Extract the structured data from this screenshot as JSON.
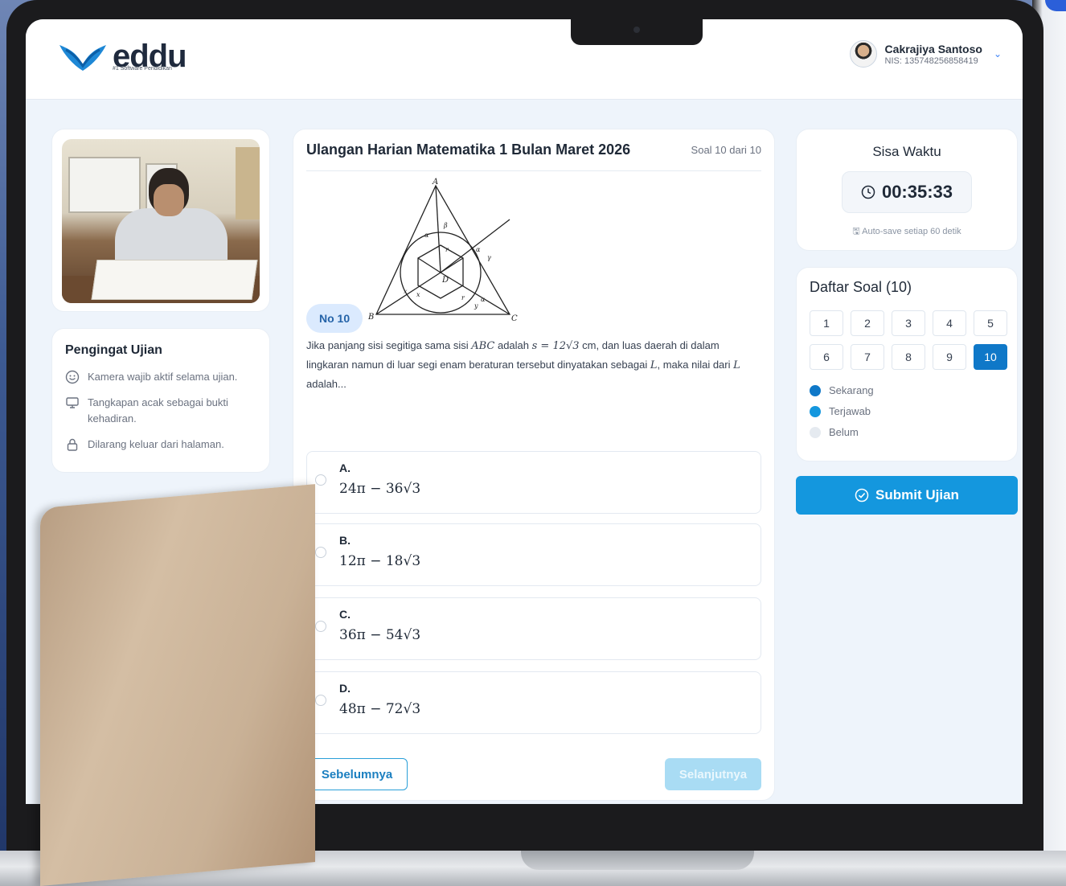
{
  "brand": {
    "name": "eddu",
    "tagline": "#1 Software Pendidikan",
    "color": "#1e88d6"
  },
  "user": {
    "name": "Cakrajiya Santoso",
    "nis": "NIS: 135748256858419"
  },
  "reminder": {
    "title": "Pengingat Ujian",
    "items": [
      {
        "icon": "smile-icon",
        "text": "Kamera wajib aktif selama ujian."
      },
      {
        "icon": "monitor-icon",
        "text": "Tangkapan acak sebagai bukti kehadiran."
      },
      {
        "icon": "lock-icon",
        "text": "Dilarang keluar dari halaman."
      }
    ]
  },
  "question": {
    "exam_title": "Ulangan Harian Matematika 1 Bulan Maret 2026",
    "counter": "Soal 10 dari 10",
    "badge": "No 10",
    "text_prefix": "Jika panjang sisi segitiga sama sisi ",
    "text_abc": "ABC",
    "text_mid": " adalah ",
    "text_s": "s = 12√3",
    "text_rest": " cm, dan luas daerah di dalam lingkaran namun di luar segi enam beraturan tersebut dinyatakan sebagai ",
    "text_L": "L",
    "text_end1": ", maka nilai dari ",
    "text_L2": "L",
    "text_end2": " adalah...",
    "figure_labels": {
      "A": "A",
      "B": "B",
      "C": "C",
      "D": "D",
      "alpha": "α",
      "beta": "β",
      "gamma": "γ",
      "r": "r",
      "x": "x",
      "y": "y"
    },
    "options": [
      {
        "letter": "A.",
        "value": "24π − 36√3"
      },
      {
        "letter": "B.",
        "value": "12π − 18√3"
      },
      {
        "letter": "C.",
        "value": "36π − 54√3"
      },
      {
        "letter": "D.",
        "value": "48π − 72√3"
      }
    ],
    "prev_label": "Sebelumnya",
    "next_label": "Selanjutnya"
  },
  "timer": {
    "title": "Sisa Waktu",
    "value": "00:35:33",
    "autosave": "Auto-save setiap 60 detik"
  },
  "question_list": {
    "title": "Daftar Soal (10)",
    "numbers": [
      "1",
      "2",
      "3",
      "4",
      "5",
      "6",
      "7",
      "8",
      "9",
      "10"
    ],
    "active": "10",
    "legend": [
      {
        "label": "Sekarang",
        "color": "#0f78c8"
      },
      {
        "label": "Terjawab",
        "color": "#1497de"
      },
      {
        "label": "Belum",
        "color": "#e5eaf0"
      }
    ]
  },
  "submit_label": "Submit Ujian"
}
